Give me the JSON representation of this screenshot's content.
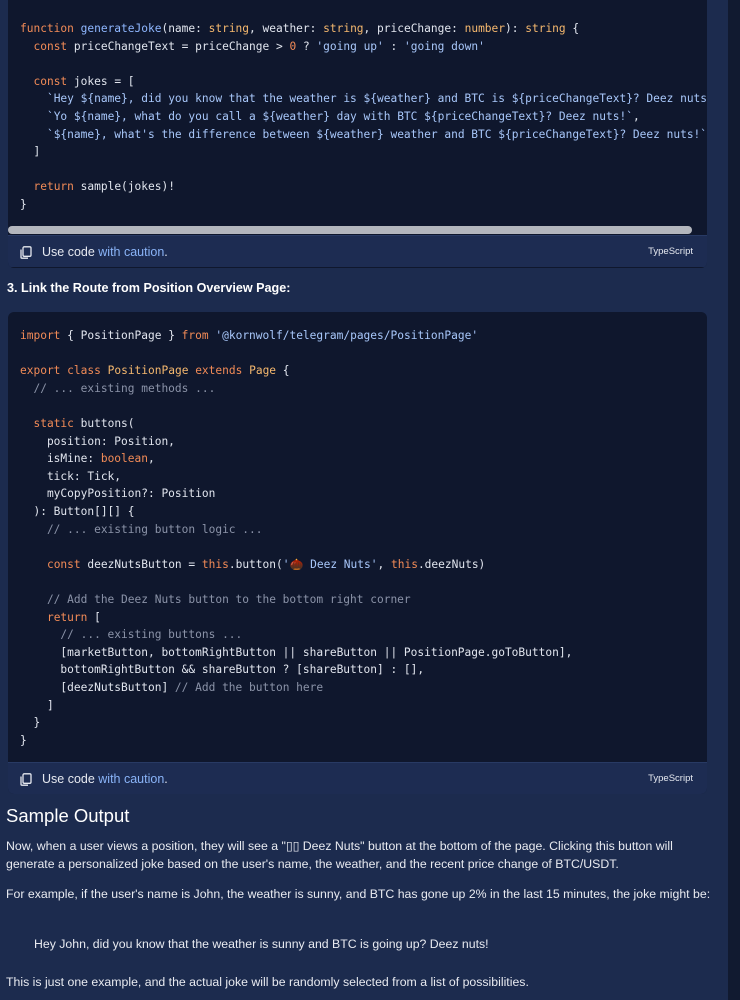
{
  "code_block_1": {
    "lines": [
      [
        {
          "c": "kw",
          "t": "function "
        },
        {
          "c": "fn",
          "t": "generateJoke"
        },
        {
          "c": "txt",
          "t": "(name: "
        },
        {
          "c": "ty",
          "t": "string"
        },
        {
          "c": "txt",
          "t": ", weather: "
        },
        {
          "c": "ty",
          "t": "string"
        },
        {
          "c": "txt",
          "t": ", priceChange: "
        },
        {
          "c": "ty",
          "t": "number"
        },
        {
          "c": "txt",
          "t": "): "
        },
        {
          "c": "ty",
          "t": "string"
        },
        {
          "c": "txt",
          "t": " {"
        }
      ],
      [
        {
          "c": "txt",
          "t": "  "
        },
        {
          "c": "kw",
          "t": "const"
        },
        {
          "c": "txt",
          "t": " priceChangeText = priceChange > "
        },
        {
          "c": "num",
          "t": "0"
        },
        {
          "c": "txt",
          "t": " ? "
        },
        {
          "c": "str",
          "t": "'going up'"
        },
        {
          "c": "txt",
          "t": " : "
        },
        {
          "c": "str",
          "t": "'going down'"
        }
      ],
      [
        {
          "c": "txt",
          "t": ""
        }
      ],
      [
        {
          "c": "txt",
          "t": "  "
        },
        {
          "c": "kw",
          "t": "const"
        },
        {
          "c": "txt",
          "t": " jokes = ["
        }
      ],
      [
        {
          "c": "txt",
          "t": "    "
        },
        {
          "c": "str",
          "t": "`Hey ${name}, did you know that the weather is ${weather} and BTC is ${priceChangeText}? Deez nuts!`"
        },
        {
          "c": "txt",
          "t": ","
        }
      ],
      [
        {
          "c": "txt",
          "t": "    "
        },
        {
          "c": "str",
          "t": "`Yo ${name}, what do you call a ${weather} day with BTC ${priceChangeText}? Deez nuts!`"
        },
        {
          "c": "txt",
          "t": ","
        }
      ],
      [
        {
          "c": "txt",
          "t": "    "
        },
        {
          "c": "str",
          "t": "`${name}, what's the difference between ${weather} weather and BTC ${priceChangeText}? Deez nuts!`"
        }
      ],
      [
        {
          "c": "txt",
          "t": "  ]"
        }
      ],
      [
        {
          "c": "txt",
          "t": ""
        }
      ],
      [
        {
          "c": "txt",
          "t": "  "
        },
        {
          "c": "kw",
          "t": "return"
        },
        {
          "c": "txt",
          "t": " sample(jokes)!"
        }
      ],
      [
        {
          "c": "txt",
          "t": "}"
        }
      ]
    ],
    "caution_prefix": "Use code ",
    "caution_link": "with caution",
    "caution_suffix": ".",
    "language": "TypeScript"
  },
  "step_heading": "3. Link the Route from Position Overview Page:",
  "code_block_2": {
    "lines": [
      [
        {
          "c": "kw",
          "t": "import"
        },
        {
          "c": "txt",
          "t": " { PositionPage } "
        },
        {
          "c": "kw",
          "t": "from"
        },
        {
          "c": "txt",
          "t": " "
        },
        {
          "c": "str",
          "t": "'@kornwolf/telegram/pages/PositionPage'"
        }
      ],
      [
        {
          "c": "txt",
          "t": ""
        }
      ],
      [
        {
          "c": "kw",
          "t": "export"
        },
        {
          "c": "txt",
          "t": " "
        },
        {
          "c": "kw",
          "t": "class"
        },
        {
          "c": "txt",
          "t": " "
        },
        {
          "c": "ty",
          "t": "PositionPage"
        },
        {
          "c": "txt",
          "t": " "
        },
        {
          "c": "kw",
          "t": "extends"
        },
        {
          "c": "txt",
          "t": " "
        },
        {
          "c": "ty",
          "t": "Page"
        },
        {
          "c": "txt",
          "t": " {"
        }
      ],
      [
        {
          "c": "cm",
          "t": "  // ... existing methods ..."
        }
      ],
      [
        {
          "c": "txt",
          "t": ""
        }
      ],
      [
        {
          "c": "txt",
          "t": "  "
        },
        {
          "c": "kw",
          "t": "static"
        },
        {
          "c": "txt",
          "t": " buttons("
        }
      ],
      [
        {
          "c": "txt",
          "t": "    position: Position,"
        }
      ],
      [
        {
          "c": "txt",
          "t": "    isMine: "
        },
        {
          "c": "kw",
          "t": "boolean"
        },
        {
          "c": "txt",
          "t": ","
        }
      ],
      [
        {
          "c": "txt",
          "t": "    tick: Tick,"
        }
      ],
      [
        {
          "c": "txt",
          "t": "    myCopyPosition?: Position"
        }
      ],
      [
        {
          "c": "txt",
          "t": "  ): Button[][] {"
        }
      ],
      [
        {
          "c": "cm",
          "t": "    // ... existing button logic ..."
        }
      ],
      [
        {
          "c": "txt",
          "t": ""
        }
      ],
      [
        {
          "c": "txt",
          "t": "    "
        },
        {
          "c": "kw",
          "t": "const"
        },
        {
          "c": "txt",
          "t": " deezNutsButton = "
        },
        {
          "c": "kw",
          "t": "this"
        },
        {
          "c": "txt",
          "t": ".button("
        },
        {
          "c": "str",
          "t": "'🌰 Deez Nuts'"
        },
        {
          "c": "txt",
          "t": ", "
        },
        {
          "c": "kw",
          "t": "this"
        },
        {
          "c": "txt",
          "t": ".deezNuts)"
        }
      ],
      [
        {
          "c": "txt",
          "t": ""
        }
      ],
      [
        {
          "c": "cm",
          "t": "    // Add the Deez Nuts button to the bottom right corner"
        }
      ],
      [
        {
          "c": "txt",
          "t": "    "
        },
        {
          "c": "kw",
          "t": "return"
        },
        {
          "c": "txt",
          "t": " ["
        }
      ],
      [
        {
          "c": "cm",
          "t": "      // ... existing buttons ..."
        }
      ],
      [
        {
          "c": "txt",
          "t": "      [marketButton, bottomRightButton || shareButton || PositionPage.goToButton],"
        }
      ],
      [
        {
          "c": "txt",
          "t": "      bottomRightButton && shareButton ? [shareButton] : [],"
        }
      ],
      [
        {
          "c": "txt",
          "t": "      [deezNutsButton] "
        },
        {
          "c": "cm",
          "t": "// Add the button here"
        }
      ],
      [
        {
          "c": "txt",
          "t": "    ]"
        }
      ],
      [
        {
          "c": "txt",
          "t": "  }"
        }
      ],
      [
        {
          "c": "txt",
          "t": "}"
        }
      ]
    ],
    "caution_prefix": "Use code ",
    "caution_link": "with caution",
    "caution_suffix": ".",
    "language": "TypeScript"
  },
  "sample_output": {
    "title": "Sample Output",
    "para1": "Now, when a user views a position, they will see a \"▯▯ Deez Nuts\" button at the bottom of the page. Clicking this button will generate a personalized joke based on the user's name, the weather, and the recent price change of BTC/USDT.",
    "para2": "For example, if the user's name is John, the weather is sunny, and BTC has gone up 2% in the last 15 minutes, the joke might be:",
    "quote": "Hey John, did you know that the weather is sunny and BTC is going up? Deez nuts!",
    "para3": "This is just one example, and the actual joke will be randomly selected from a list of possibilities."
  }
}
